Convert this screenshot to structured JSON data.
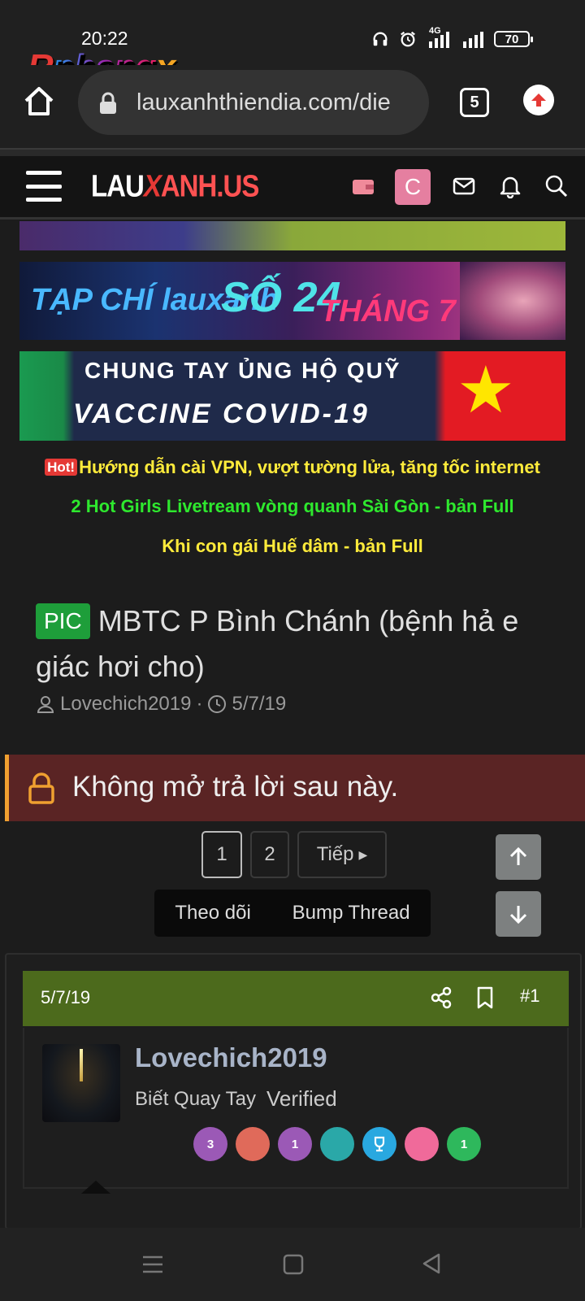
{
  "status_bar": {
    "time": "20:22",
    "battery": "70",
    "network": "4G"
  },
  "watermark": {
    "first": "R",
    "rest": "phang",
    "x": "x"
  },
  "browser": {
    "url": "lauxanhthiendia.com/die",
    "tab_count": "5"
  },
  "site": {
    "logo_lau": "LAU",
    "logo_x": "X",
    "logo_rest": "ANH.US",
    "avatar_letter": "C"
  },
  "banners": {
    "magazine_title": "TẠP CHÍ lauxanh",
    "magazine_issue": "SỐ 24",
    "magazine_month": "THÁNG 7",
    "covid_line1": "CHUNG TAY ỦNG HỘ QUỸ",
    "covid_line2": "VACCINE COVID-19"
  },
  "promos": {
    "hot_badge": "Hot!",
    "link1": "Hướng dẫn cài VPN, vượt tường lửa, tăng tốc internet",
    "link2": "2 Hot Girls Livetream vòng quanh Sài Gòn - bản Full",
    "link3": "Khi con gái Huế dâm - bản Full"
  },
  "thread": {
    "prefix": "PIC",
    "title": "MBTC P Bình Chánh (bệnh hả e giác hơi cho)",
    "author": "Lovechich2019",
    "date": "5/7/19",
    "locked_message": "Không mở trả lời sau này."
  },
  "pagination": {
    "pages": [
      "1",
      "2"
    ],
    "next_label": "Tiếp"
  },
  "actions": {
    "watch": "Theo dõi",
    "bump": "Bump Thread"
  },
  "post": {
    "date": "5/7/19",
    "number": "#1",
    "username": "Lovechich2019",
    "user_title": "Biết Quay Tay",
    "verified": "Verified",
    "trophies": [
      {
        "label": "3",
        "color": "#9b59b6"
      },
      {
        "label": "",
        "color": "#e06a5a"
      },
      {
        "label": "1",
        "color": "#9b59b6"
      },
      {
        "label": "",
        "color": "#2aa8a8"
      },
      {
        "label": "",
        "color": "#29a8e0"
      },
      {
        "label": "",
        "color": "#f06a9a"
      },
      {
        "label": "1",
        "color": "#2eb85c"
      }
    ]
  }
}
